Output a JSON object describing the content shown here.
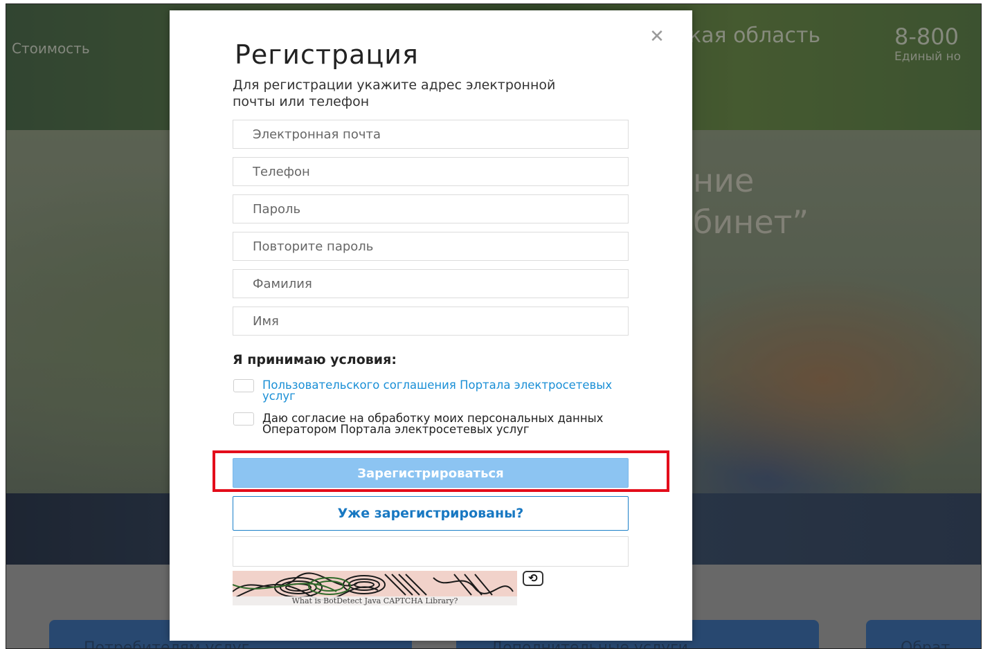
{
  "background": {
    "header_left_link": "Стоимость",
    "header_region": "кая область",
    "header_phone": "8-800",
    "header_phone_caption": "Единый но",
    "hero_line1": "ние",
    "hero_line2": "бинет”",
    "cards": [
      "Потребителям услуг",
      "Дополнительные услуги",
      "Обрат"
    ]
  },
  "modal": {
    "close_icon": "close-icon",
    "title": "Регистрация",
    "subtitle": "Для регистрации укажите адрес электронной почты или телефон",
    "fields": {
      "email_placeholder": "Электронная почта",
      "phone_placeholder": "Телефон",
      "password_placeholder": "Пароль",
      "password_repeat_placeholder": "Повторите пароль",
      "surname_placeholder": "Фамилия",
      "name_placeholder": "Имя"
    },
    "terms_heading": "Я принимаю условия:",
    "terms": [
      {
        "label": "Пользовательского соглашения Портала электросетевых услуг",
        "checked": false
      },
      {
        "label": "Даю согласие на обработку моих персональных данных Оператором Портала электросетевых услуг",
        "checked": false
      }
    ],
    "register_button": "Зарегистрироваться",
    "login_button": "Уже зарегистрированы?",
    "captcha_caption": "What is BotDetect Java CAPTCHA Library?",
    "captcha_refresh_icon": "refresh-icon"
  },
  "colors": {
    "link": "#1a8fd6",
    "register_button": "#8cc4f2",
    "login_border": "#1a7fc8",
    "highlight": "#e30d1b"
  }
}
